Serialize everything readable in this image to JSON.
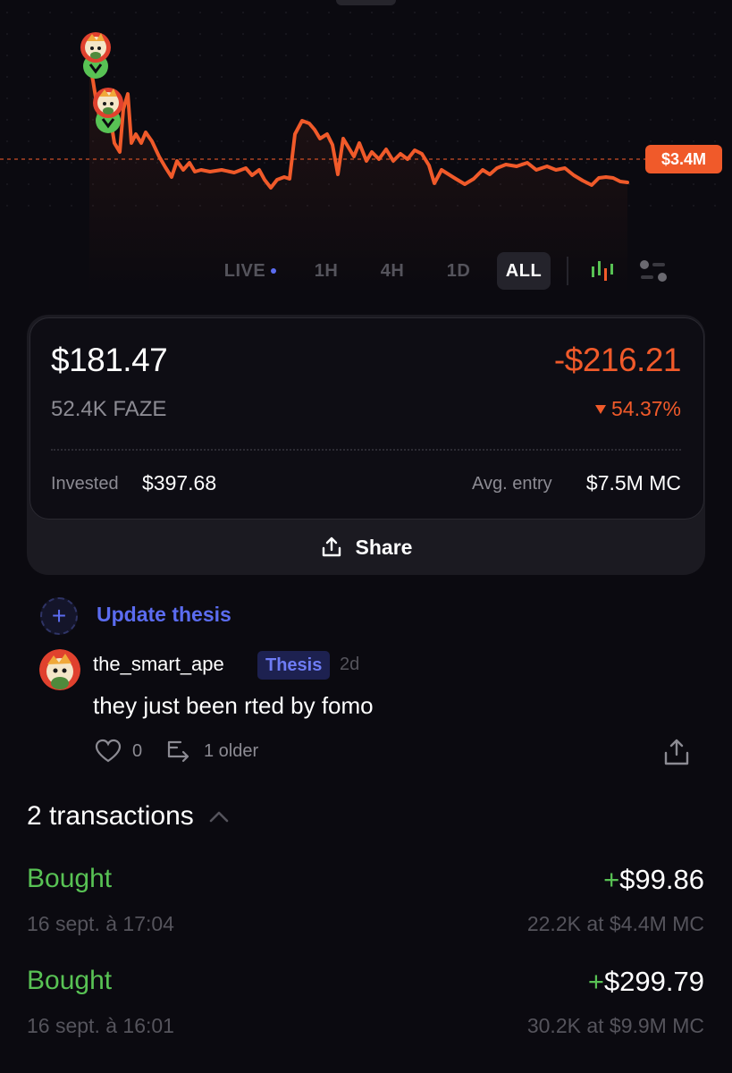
{
  "chart": {
    "current_price_label": "$3.4M",
    "line_color": "#f05a2a"
  },
  "ranges": [
    {
      "label": "LIVE",
      "active": false
    },
    {
      "label": "1H",
      "active": false
    },
    {
      "label": "4H",
      "active": false
    },
    {
      "label": "1D",
      "active": false
    },
    {
      "label": "ALL",
      "active": true
    }
  ],
  "position": {
    "value": "$181.47",
    "pnl": "-$216.21",
    "amount": "52.4K FAZE",
    "pnl_percent": "54.37%",
    "invested_label": "Invested",
    "invested_value": "$397.68",
    "avg_entry_label": "Avg. entry",
    "avg_entry_value": "$7.5M MC",
    "share_label": "Share"
  },
  "thesis": {
    "update_label": "Update thesis",
    "username": "the_smart_ape",
    "badge": "Thesis",
    "age": "2d",
    "text": "they just been rted by fomo",
    "likes": "0",
    "older": "1 older"
  },
  "transactions": {
    "header": "2 transactions",
    "items": [
      {
        "type": "Bought",
        "amount_sign": "+",
        "amount": "$99.86",
        "date": "16 sept. à 17:04",
        "detail": "22.2K at $4.4M MC"
      },
      {
        "type": "Bought",
        "amount_sign": "+",
        "amount": "$299.79",
        "date": "16 sept. à 16:01",
        "detail": "30.2K at $9.9M MC"
      }
    ]
  },
  "colors": {
    "accent": "#5b6cf0",
    "loss": "#f05a2a",
    "gain": "#58c254",
    "background": "#0b0a10"
  }
}
